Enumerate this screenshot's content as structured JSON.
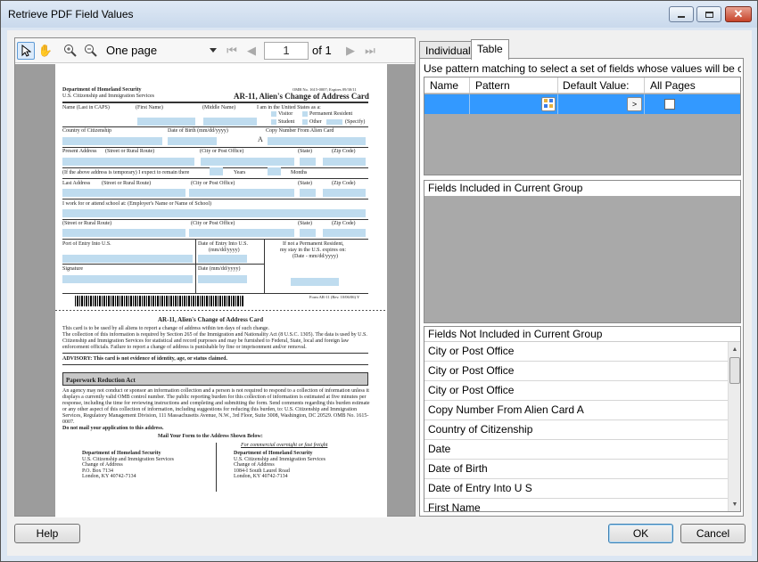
{
  "window": {
    "title": "Retrieve PDF Field Values"
  },
  "viewer": {
    "zoom": "One page",
    "current_page": "1",
    "page_count_label": "of 1",
    "document": {
      "agency": "Department of Homeland Security",
      "agency_sub": "U.S. Citizenship and Immigration Services",
      "omb": "OMB No. 1615-0007; Expires 09/30/11",
      "form_title": "AR-11, Alien's Change of Address Card",
      "name_last": "Name (Last in CAPS)",
      "name_first": "(First Name)",
      "name_middle": "(Middle Name)",
      "status_label": "I am in the United States as a:",
      "visitor": "Visitor",
      "permanent": "Permanent Resident",
      "student": "Student",
      "other": "Other",
      "specify": "(Specify)",
      "country": "Country of Citizenship",
      "dob": "Date of Birth (mm/dd/yyyy)",
      "copy_number": "Copy Number From Alien Card",
      "a_prefix": "A",
      "present_address": "Present Address",
      "street": "(Street or Rural Route)",
      "city": "(City or Post Office)",
      "state": "(State)",
      "zip": "(Zip Code)",
      "temp_note": "(If the above address is temporary) I expect to remain there",
      "years": "Years",
      "months": "Months",
      "last_address": "Last Address",
      "work_school": "I work for or attend school at:   (Employer's Name or Name of School)",
      "port_entry": "Port of Entry Into U.S.",
      "date_entry": "Date of Entry Into U.S.",
      "mmddyyyy": "(mm/dd/yyyy)",
      "not_perm": "If not a Permanent Resident,",
      "stay_expires": "my stay in the U.S. expires on:",
      "date_mm": "(Date - mm/dd/yyyy)",
      "signature": "Signature",
      "date_label": "Date (mm/dd/yyyy)",
      "form_id": "Form AR-11 (Rev. 10/06/06) Y",
      "card_heading": "AR-11, Alien's Change of Address Card",
      "para1": "This card is to be used by all aliens to report a change of address within ten days of such change.",
      "para2": "The collection of this information is required by Section 265 of the Immigration and Nationality Act (8 U.S.C. 1305). The data is used by U.S. Citizenship and Immigration Services for statistical and record purposes and may be furnished to Federal, State, local and foreign law enforcement officials. Failure to report a change of address is punishable by fine or imprisonment and/or removal.",
      "advisory": "ADVISORY: This card is not evidence of identity, age, or status claimed.",
      "pra_heading": "Paperwork Reduction Act",
      "pra_text": "An agency may not conduct or sponsor an information collection and a person is not required to respond to a collection of information unless it displays a currently valid OMB control number. The public reporting burden for this collection of information is estimated at five minutes per response, including the time for reviewing instructions and completing and submitting the form. Send comments regarding this burden estimate or any other aspect of this collection of information, including suggestions for reducing this burden, to: U.S. Citizenship and Immigration Services, Regulatory Management Division, 111 Massachusetts Avenue, N.W., 3rd Floor, Suite 3008, Washington, DC 20529. OMB No. 1615-0007.",
      "pra_bold": "Do not mail your application to this address.",
      "mail_heading": "Mail Your Form to the Address Shown Below:",
      "overnight": "For commercial overnight or fast freight",
      "addr1": [
        "Department of Homeland Security",
        "U.S. Citizenship and Immigration Services",
        "Change of Address",
        "P.O. Box 7134",
        "London, KY  40742-7134"
      ],
      "addr2": [
        "Department of Homeland Security",
        "U.S. Citizenship and Immigration Services",
        "Change of Address",
        "1084-I South Laurel Road",
        "London, KY  40742-7134"
      ]
    }
  },
  "tabs": [
    {
      "label": "Individual"
    },
    {
      "label": "Table"
    }
  ],
  "table_tab": {
    "hint": "Use pattern matching to select a set of fields whose values will be combin...",
    "columns": [
      "Name",
      "Pattern",
      "Default Value:",
      "All Pages"
    ],
    "row_button": ">"
  },
  "included_group": {
    "header": "Fields Included in Current Group"
  },
  "not_included_group": {
    "header": "Fields Not Included in Current Group",
    "items": [
      "City or Post Office",
      "City or Post Office",
      "City or Post Office",
      "Copy Number From Alien Card A",
      "Country of Citizenship",
      "Date",
      "Date of Birth",
      "Date of Entry Into U S",
      "First Name"
    ]
  },
  "buttons": {
    "help": "Help",
    "ok": "OK",
    "cancel": "Cancel"
  },
  "colors": {
    "selection": "#3399ff",
    "field_fill": "#bfdcef"
  }
}
